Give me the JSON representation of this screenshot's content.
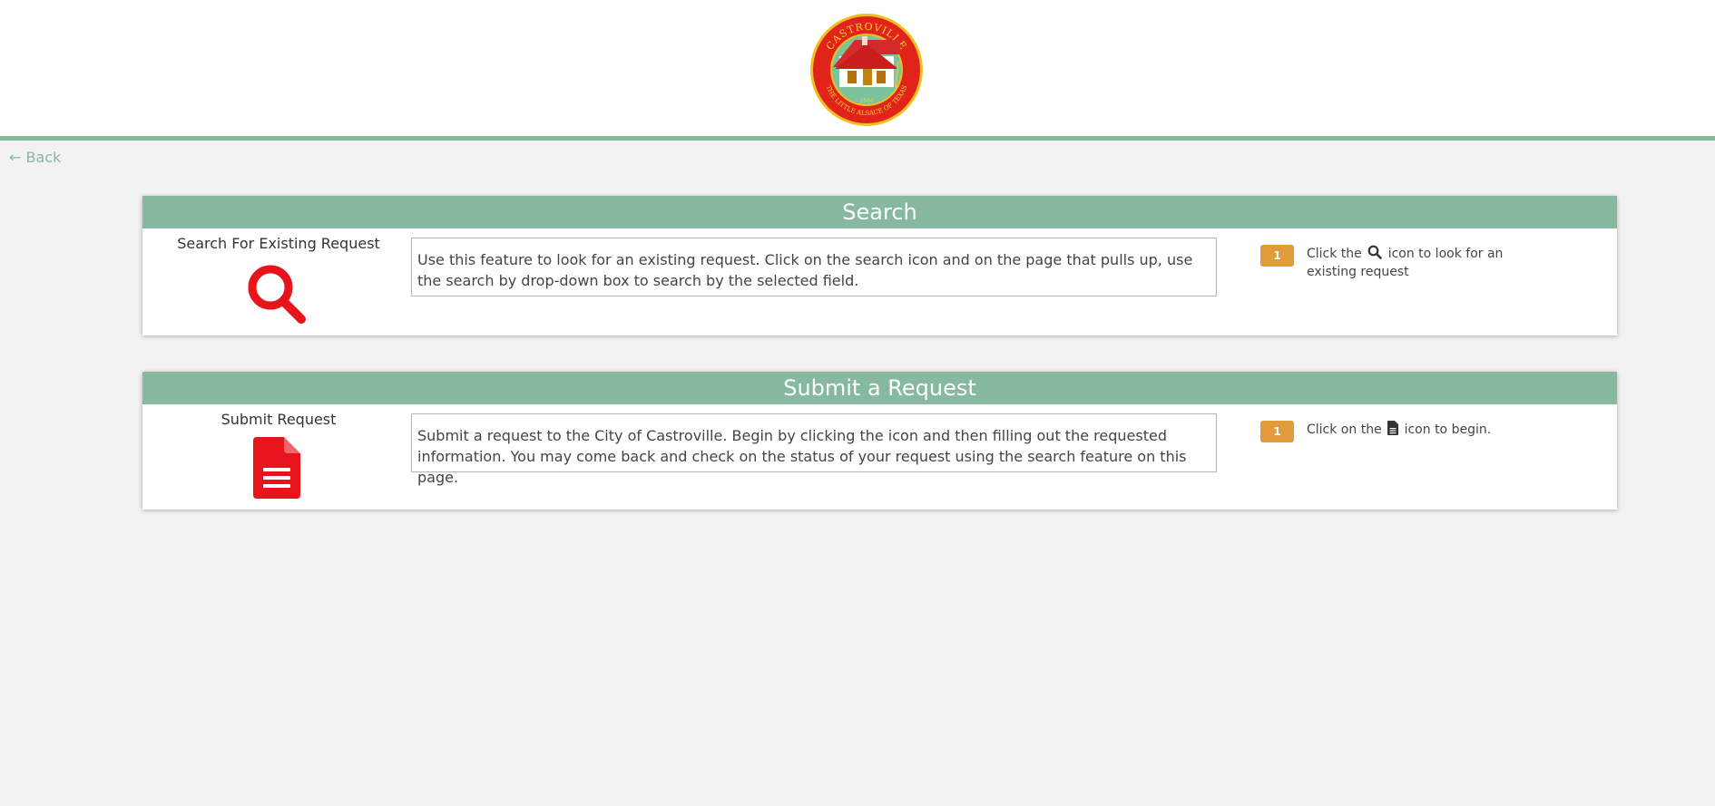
{
  "header": {
    "seal": {
      "name": "city-seal",
      "top_text": "CASTROVILLE",
      "bottom_text": "THE LITTLE ALSACE OF TEXAS",
      "year": "1844"
    }
  },
  "nav": {
    "back_label": "← Back"
  },
  "colors": {
    "accent": "#86b99f",
    "icon_red": "#e8141c",
    "badge_orange": "#e19b3a",
    "background": "#f2f2f2"
  },
  "panels": [
    {
      "title": "Search",
      "feature_label": "Search For Existing Request",
      "feature_icon": "search-icon",
      "description": "Use this feature to look for an existing request. Click on the search icon and on the page that pulls up, use the search by drop-down box to search by the selected field.",
      "step_number": "1",
      "step_text_before": "Click the",
      "step_icon": "search-icon",
      "step_text_after": "icon to look for an existing request"
    },
    {
      "title": "Submit a Request",
      "feature_label": "Submit Request",
      "feature_icon": "document-icon",
      "description": "Submit a request to the City of Castroville. Begin by clicking the icon and then filling out the requested information. You may come back and check on the status of your request using the search feature on this page.",
      "step_number": "1",
      "step_text_before": "Click on the",
      "step_icon": "document-icon",
      "step_text_after": "icon to begin."
    }
  ]
}
